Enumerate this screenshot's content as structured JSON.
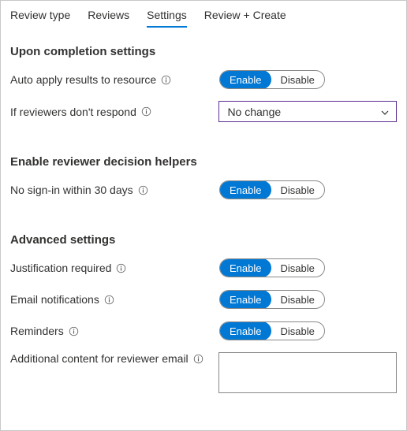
{
  "tabs": {
    "review_type": "Review type",
    "reviews": "Reviews",
    "settings": "Settings",
    "review_create": "Review + Create"
  },
  "sections": {
    "completion": {
      "title": "Upon completion settings",
      "auto_apply": {
        "label": "Auto apply results to resource",
        "enable": "Enable",
        "disable": "Disable",
        "selected": "enable"
      },
      "no_respond": {
        "label": "If reviewers don't respond",
        "value": "No change"
      }
    },
    "helpers": {
      "title": "Enable reviewer decision helpers",
      "no_signin": {
        "label": "No sign-in within 30 days",
        "enable": "Enable",
        "disable": "Disable",
        "selected": "enable"
      }
    },
    "advanced": {
      "title": "Advanced settings",
      "justification": {
        "label": "Justification required",
        "enable": "Enable",
        "disable": "Disable",
        "selected": "enable"
      },
      "email": {
        "label": "Email notifications",
        "enable": "Enable",
        "disable": "Disable",
        "selected": "enable"
      },
      "reminders": {
        "label": "Reminders",
        "enable": "Enable",
        "disable": "Disable",
        "selected": "enable"
      },
      "additional": {
        "label": "Additional content for reviewer email",
        "value": ""
      }
    }
  }
}
